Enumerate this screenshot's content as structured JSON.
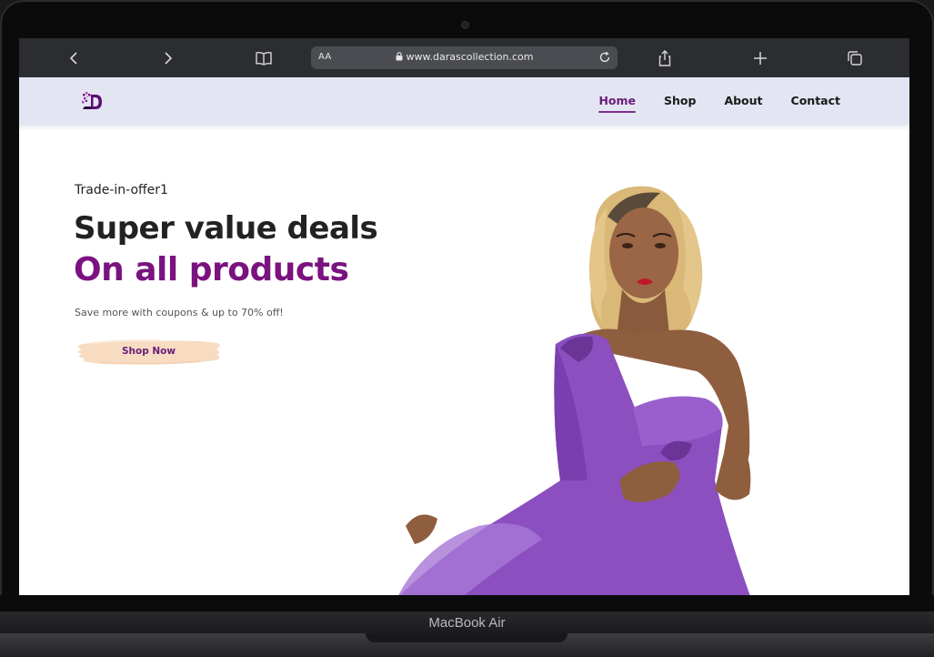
{
  "browser": {
    "aa_label": "AA",
    "url": "www.darascollection.com"
  },
  "site": {
    "nav": [
      {
        "label": "Home",
        "active": true
      },
      {
        "label": "Shop",
        "active": false
      },
      {
        "label": "About",
        "active": false
      },
      {
        "label": "Contact",
        "active": false
      }
    ]
  },
  "hero": {
    "kicker": "Trade-in-offer1",
    "headline": "Super value deals",
    "headline_accent": "On all products",
    "subtitle": "Save more with coupons & up to 70% off!",
    "cta_label": "Shop Now"
  },
  "device": {
    "label": "MacBook Air"
  },
  "colors": {
    "accent": "#7a127f",
    "header_bg": "#e3e6f2",
    "cta_bg": "#f7dcc2",
    "browser_bar": "#2b2d31"
  }
}
